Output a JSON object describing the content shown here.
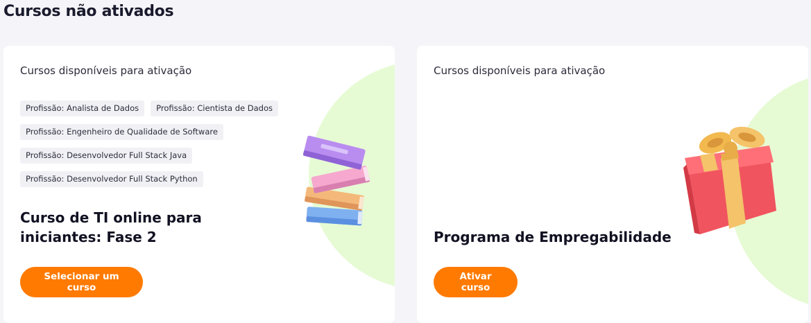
{
  "page": {
    "title": "Cursos não ativados"
  },
  "cards": [
    {
      "subtitle": "Cursos disponíveis para ativação",
      "tags": [
        "Profissão: Analista de Dados",
        "Profissão: Cientista de Dados",
        "Profissão: Engenheiro de Qualidade de Software",
        "Profissão: Desenvolvedor Full Stack Java",
        "Profissão: Desenvolvedor Full Stack Python"
      ],
      "course_title": "Curso de TI online para iniciantes: Fase 2",
      "button_label": "Selecionar um curso",
      "illustration": "books-stack-icon"
    },
    {
      "subtitle": "Cursos disponíveis para ativação",
      "tags": [],
      "course_title": "Programa de Empregabilidade",
      "button_label": "Ativar curso",
      "illustration": "gift-box-icon"
    }
  ],
  "colors": {
    "accent": "#ff7a00",
    "background": "#f5f5f9",
    "blob": "#e6fbd4",
    "tag_bg": "#f1f1f5"
  }
}
